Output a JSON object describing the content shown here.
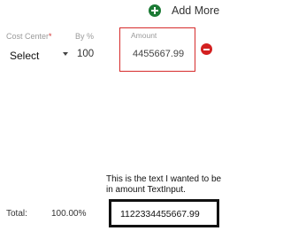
{
  "header": {
    "add_more_label": "Add More"
  },
  "row": {
    "cost_center": {
      "label": "Cost Center",
      "required_mark": "*",
      "selected": "Select"
    },
    "by_percent": {
      "label": "By %",
      "value": "100"
    },
    "amount": {
      "label": "Amount",
      "value": "4455667.99"
    }
  },
  "annotation": {
    "text": "This is the text I wanted to be in amount TextInput."
  },
  "total": {
    "label": "Total:",
    "percent": "100.00%",
    "amount": "1122334455667.99"
  },
  "colors": {
    "add_icon": "#1b7a34",
    "remove_icon": "#d32020",
    "highlight_border": "#d62b2b",
    "annotation_border": "#111111"
  },
  "icons": {
    "add": "plus-circle-icon",
    "remove": "minus-circle-icon",
    "dropdown": "chevron-down-icon"
  }
}
